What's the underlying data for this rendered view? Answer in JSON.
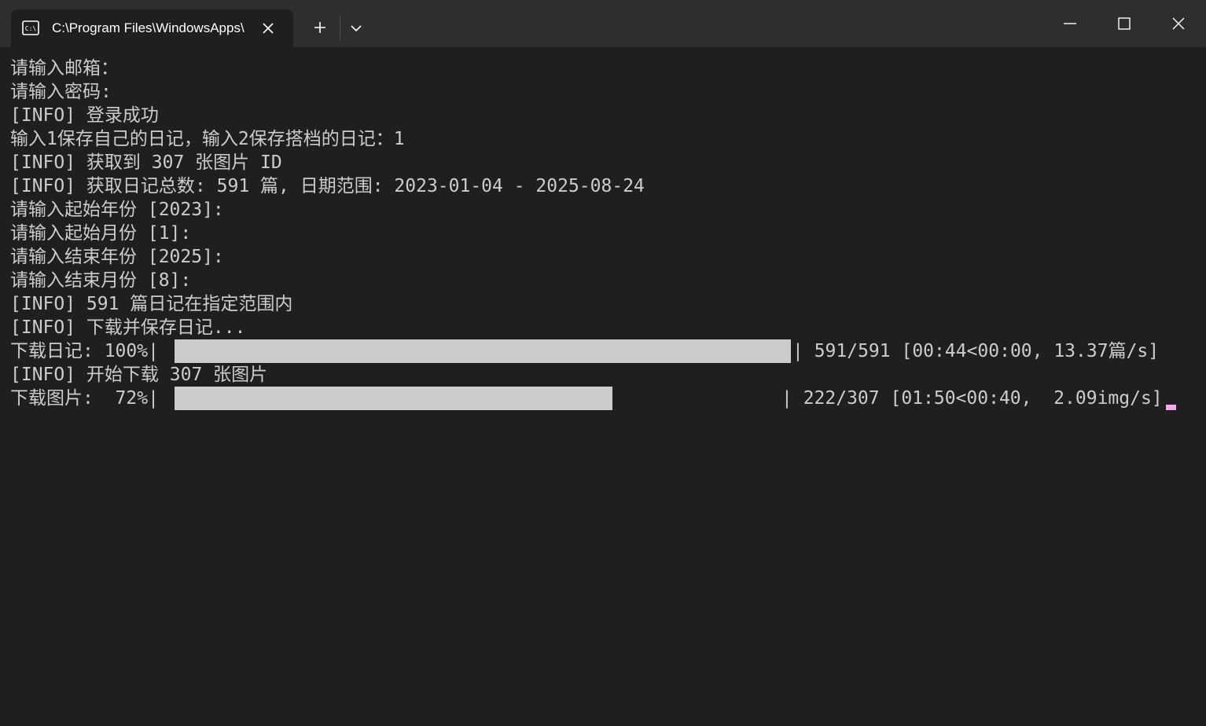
{
  "window": {
    "tab_title": "C:\\Program Files\\WindowsApps\\",
    "tab_icon": "terminal-icon",
    "colors": {
      "titlebar": "#2e2e2e",
      "background": "#1f1f1f",
      "text": "#cccccc",
      "cursor": "#f2a7f2"
    }
  },
  "terminal": {
    "lines": [
      "请输入邮箱：",
      "请输入密码:",
      "[INFO] 登录成功",
      "输入1保存自己的日记，输入2保存搭档的日记：1",
      "[INFO] 获取到 307 张图片 ID",
      "[INFO] 获取日记总数: 591 篇, 日期范围: 2023-01-04 - 2025-08-24",
      "请输入起始年份 [2023]:",
      "请输入起始月份 [1]:",
      "请输入结束年份 [2025]:",
      "请输入结束月份 [8]:",
      "[INFO] 591 篇日记在指定范围内",
      "[INFO] 下载并保存日记..."
    ],
    "progress_diary": {
      "prefix": "下载日记: 100%|",
      "percent": 100,
      "suffix": "| 591/591 [00:44<00:00, 13.37篇/s]"
    },
    "info_images": "[INFO] 开始下载 307 张图片",
    "progress_images": {
      "prefix": "下载图片:  72%|",
      "percent": 72,
      "suffix": "| 222/307 [01:50<00:40,  2.09img/s]"
    }
  }
}
